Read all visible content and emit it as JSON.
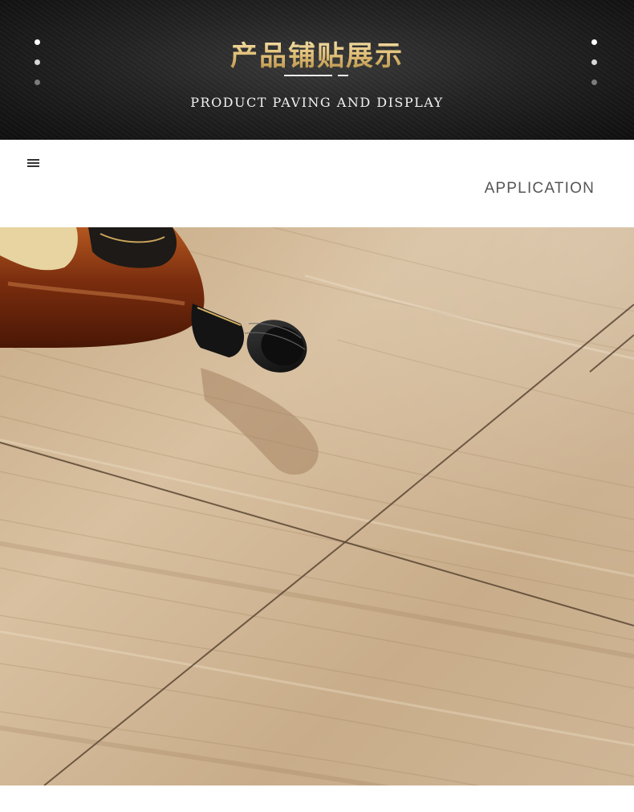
{
  "banner": {
    "title_cn": "产品铺贴展示",
    "title_en": "PRODUCT PAVING AND DISPLAY"
  },
  "section": {
    "menu_icon": "menu-icon",
    "label": "APPLICATION"
  },
  "photo": {
    "subject": "wood-look floor tiles with a liquor bottle"
  },
  "colors": {
    "banner_dark": "#1a1a1a",
    "title_gold": "#e0be75",
    "wood_light": "#cdb394",
    "bottle_amber": "#8a3a12"
  }
}
